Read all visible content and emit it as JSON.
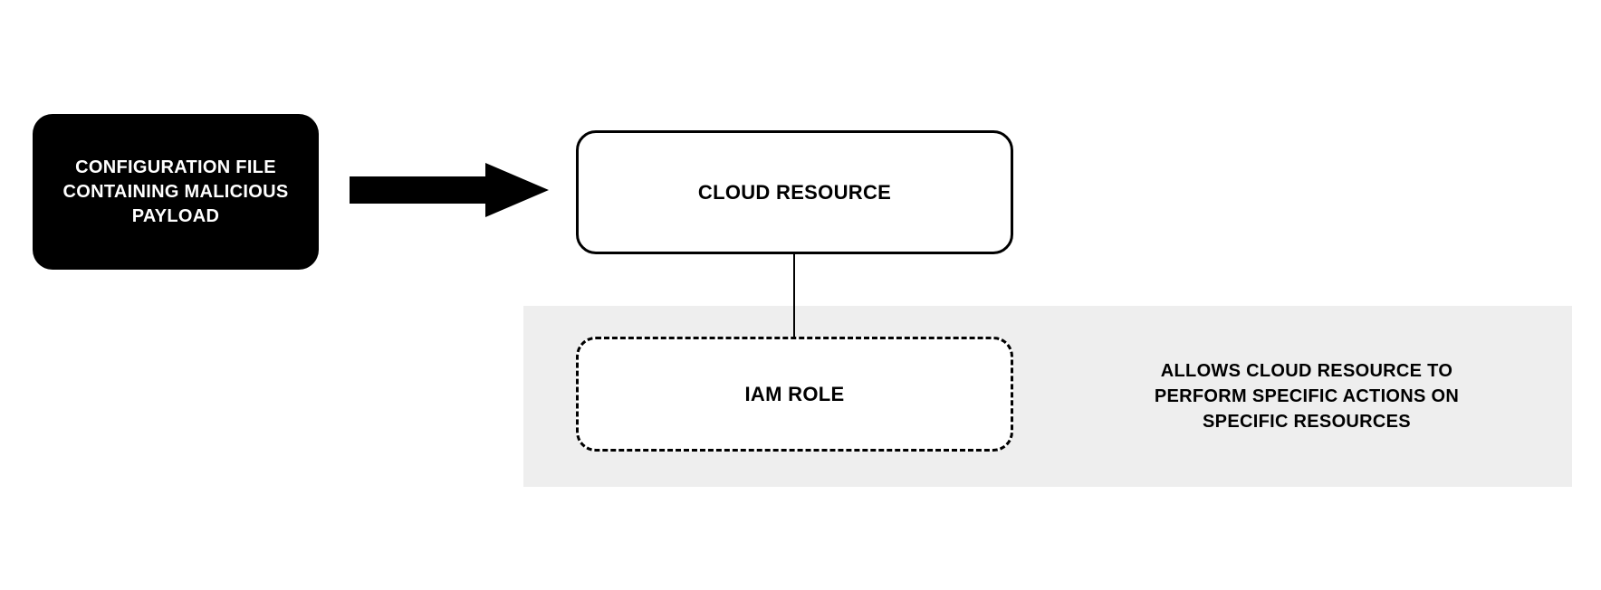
{
  "nodes": {
    "config": {
      "label": "CONFIGURATION FILE CONTAINING MALICIOUS PAYLOAD"
    },
    "cloud": {
      "label": "CLOUD RESOURCE"
    },
    "iam": {
      "label": "IAM ROLE"
    }
  },
  "description": "ALLOWS CLOUD RESOURCE TO PERFORM SPECIFIC ACTIONS ON SPECIFIC RESOURCES",
  "colors": {
    "blackBox": "#000000",
    "whiteBox": "#ffffff",
    "panel": "#eeeeee",
    "stroke": "#000000"
  }
}
